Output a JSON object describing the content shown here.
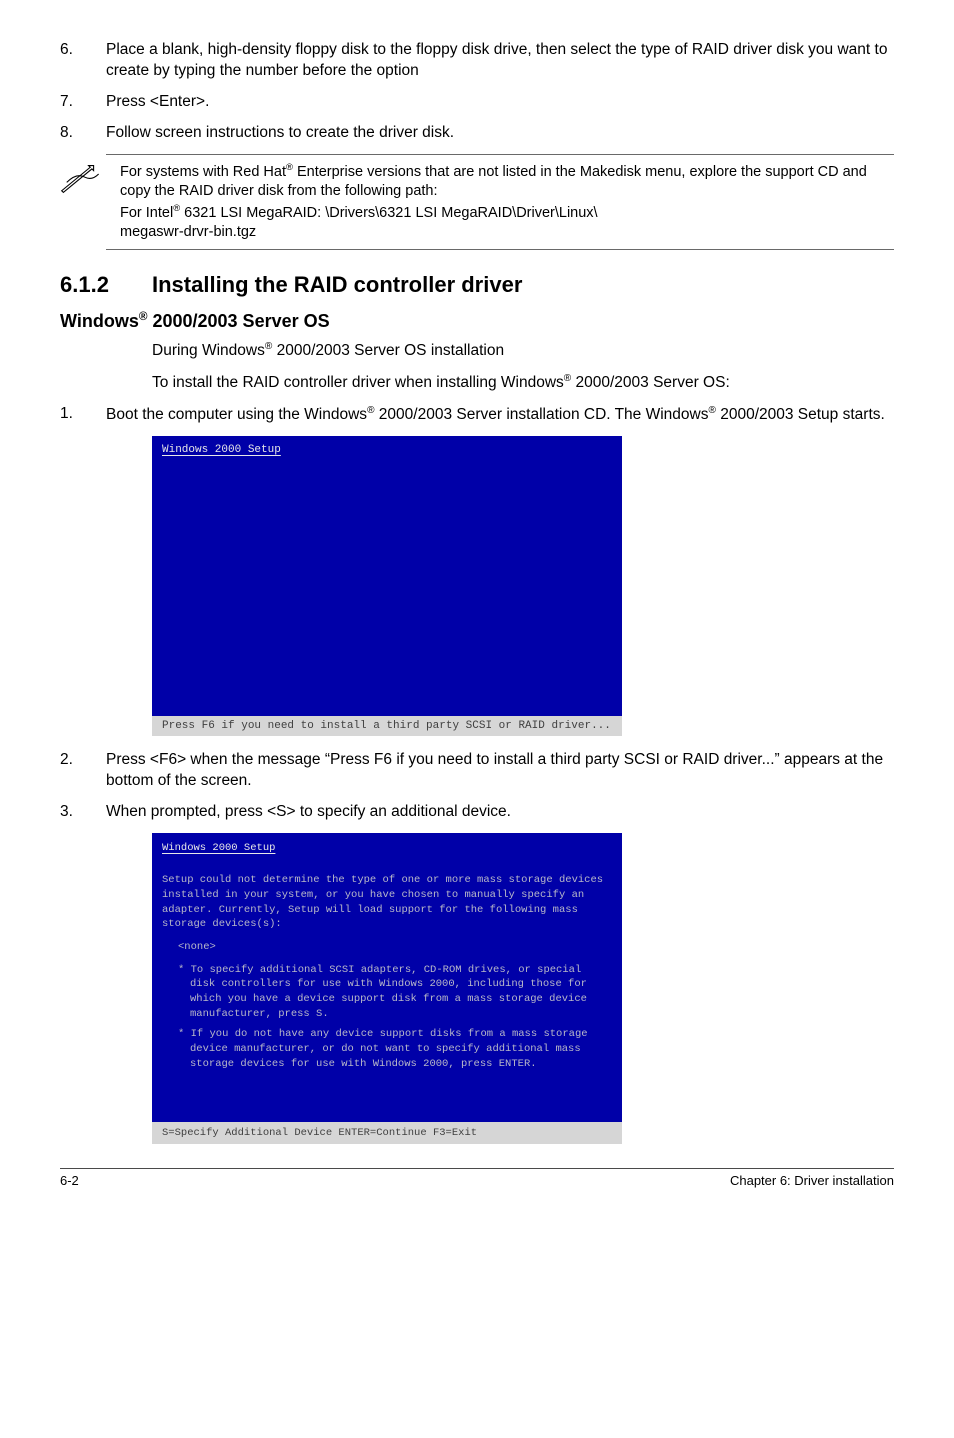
{
  "steps_top": {
    "s6_num": "6.",
    "s6_txt": "Place a blank, high-density floppy disk to the floppy disk drive, then select the type of RAID driver disk you want to create by typing the number before the option",
    "s7_num": "7.",
    "s7_txt": "Press <Enter>.",
    "s8_num": "8.",
    "s8_txt": "Follow screen instructions to create the driver disk."
  },
  "note": {
    "line1a": "For systems with Red Hat",
    "line1b": " Enterprise versions that are not listed in the Makedisk menu, explore the support CD and copy the RAID driver disk from the following path:",
    "line2a": "For Intel",
    "line2b": " 6321 LSI MegaRAID: \\Drivers\\6321 LSI MegaRAID\\Driver\\Linux\\",
    "line3": "megaswr-drvr-bin.tgz"
  },
  "section": {
    "num": "6.1.2",
    "title": "Installing the RAID controller driver"
  },
  "subhead": {
    "pre": "Windows",
    "post": " 2000/2003 Server OS"
  },
  "intro1_pre": "During Windows",
  "intro1_post": " 2000/2003 Server OS installation",
  "intro2_pre": "To install the RAID controller driver when installing  Windows",
  "intro2_post": " 2000/2003 Server OS:",
  "steps_mid": {
    "s1_num": "1.",
    "s1a": "Boot the computer using the Windows",
    "s1b": " 2000/2003 Server installation CD. The Windows",
    "s1c": " 2000/2003 Setup starts."
  },
  "bs1": {
    "title": "Windows 2000 Setup",
    "footer": "  Press F6 if you need to install a third party SCSI or RAID driver..."
  },
  "steps_bottom": {
    "s2_num": "2.",
    "s2_txt": "Press <F6> when the message “Press F6 if you need to install a third party SCSI or RAID driver...” appears at the bottom of the screen.",
    "s3_num": "3.",
    "s3_txt": "When prompted, press <S> to specify an additional device."
  },
  "bs2": {
    "title": "Windows 2000 Setup",
    "para1": "Setup could not determine the type of one or more mass storage devices installed in your system, or you have chosen to manually specify an adapter. Currently, Setup will load support for the following mass storage devices(s):",
    "none": "<none>",
    "bullet1": "* To specify additional SCSI adapters, CD-ROM drives, or special disk controllers for use with Windows 2000, including those for which you have a device support disk from a mass storage device manufacturer, press S.",
    "bullet2": "* If you do not have any device support disks from a mass storage device manufacturer, or do not want to specify additional mass storage devices for use with Windows 2000, press ENTER.",
    "footer": "S=Specify Additional Device   ENTER=Continue   F3=Exit"
  },
  "footer": {
    "left": "6-2",
    "right": "Chapter 6: Driver installation"
  },
  "sup": "®"
}
